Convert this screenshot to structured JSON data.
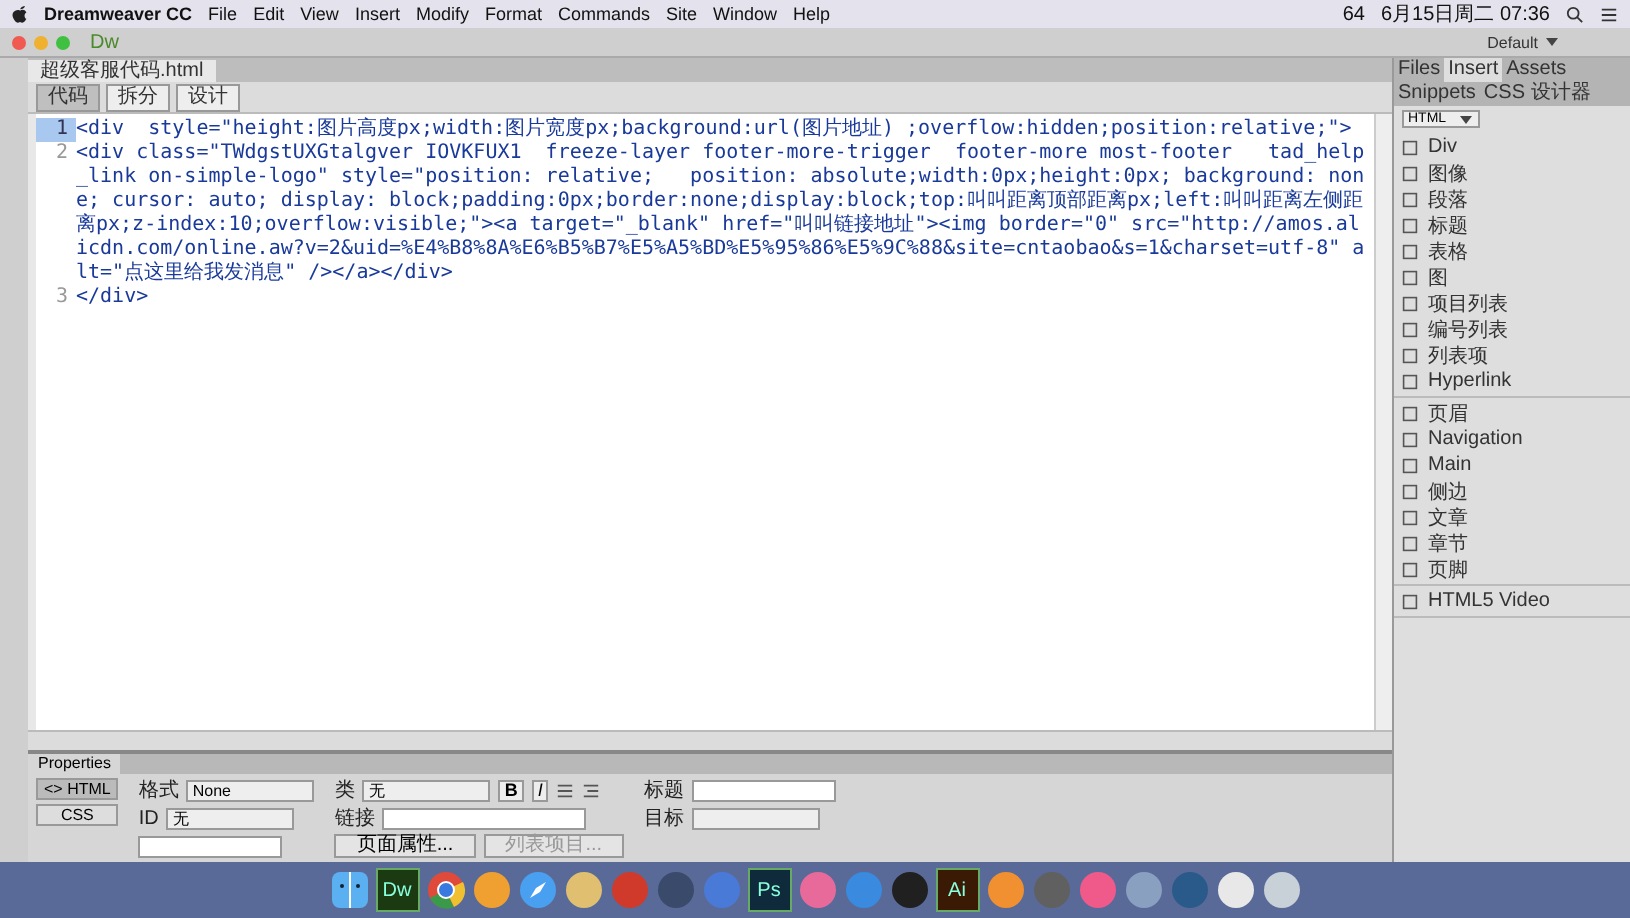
{
  "menubar": {
    "app": "Dreamweaver CC",
    "items": [
      "File",
      "Edit",
      "View",
      "Insert",
      "Modify",
      "Format",
      "Commands",
      "Site",
      "Window",
      "Help"
    ],
    "battery": "64",
    "clock": "6月15日周二 07:36"
  },
  "window": {
    "logo": "Dw",
    "workspace": "Default"
  },
  "document_tab": "超级客服代码.html",
  "view_buttons": [
    {
      "label": "代码",
      "selected": true
    },
    {
      "label": "拆分",
      "selected": false
    },
    {
      "label": "设计",
      "selected": false
    }
  ],
  "code_lines": [
    {
      "number": "1",
      "text": "<div  style=\"height:图片高度px;width:图片宽度px;background:url(图片地址) ;overflow:hidden;position:relative;\">"
    },
    {
      "number": "2",
      "text": "<div class=\"TWdgstUXGtalgver IOVKFUX1  freeze-layer footer-more-trigger  footer-more most-footer   tad_help_link on-simple-logo\" style=\"position: relative;   position: absolute;width:0px;height:0px; background: none; cursor: auto; display: block;padding:0px;border:none;display:block;top:叫叫距离顶部距离px;left:叫叫距离左侧距离px;z-index:10;overflow:visible;\"><a target=\"_blank\" href=\"叫叫链接地址\"><img border=\"0\" src=\"http://amos.alicdn.com/online.aw?v=2&uid=%E4%B8%8A%E6%B5%B7%E5%A5%BD%E5%95%86%E5%9C%88&site=cntaobao&s=1&charset=utf-8\" alt=\"点这里给我发消息\" /></a></div>"
    },
    {
      "number": "3",
      "text": "</div>"
    }
  ],
  "panel": {
    "tabs": [
      {
        "label": "Files",
        "selected": false
      },
      {
        "label": "Insert",
        "selected": true
      },
      {
        "label": "Assets",
        "selected": false
      },
      {
        "label": "Snippets",
        "selected": false
      },
      {
        "label": "CSS 设计器",
        "selected": false
      }
    ],
    "category": "HTML",
    "sections": [
      [
        "Div",
        "图像",
        "段落",
        "标题",
        "表格",
        "图",
        "项目列表",
        "编号列表",
        "列表项",
        "Hyperlink"
      ],
      [
        "页眉",
        "Navigation",
        "Main",
        "侧边",
        "文章",
        "章节",
        "页脚"
      ],
      [
        "HTML5 Video"
      ]
    ]
  },
  "properties": {
    "title": "Properties",
    "modes": [
      {
        "label": "<> HTML",
        "selected": true
      },
      {
        "label": "CSS",
        "selected": false
      }
    ],
    "bold_button": "B",
    "italic_button": "I",
    "format_label": "格式",
    "format_value": "None",
    "class_label": "类",
    "class_value": "无",
    "id_label": "ID",
    "id_value": "无",
    "link_label": "链接",
    "title_label": "标题",
    "target_label": "目标",
    "page_button": "页面属性...",
    "list_button": "列表项目..."
  },
  "dock": [
    {
      "kind": "finder"
    },
    {
      "kind": "tile",
      "label": "Dw",
      "color": "#1b3a12"
    },
    {
      "kind": "chrome"
    },
    {
      "kind": "circle",
      "color": "#f0a030"
    },
    {
      "kind": "compass"
    },
    {
      "kind": "circle",
      "color": "#e0c070"
    },
    {
      "kind": "circle",
      "color": "#d03a2a"
    },
    {
      "kind": "circle",
      "color": "#3a4a6a"
    },
    {
      "kind": "circle",
      "color": "#4a7ad8"
    },
    {
      "kind": "tile",
      "label": "Ps",
      "color": "#0f2a3a"
    },
    {
      "kind": "circle",
      "color": "#e86a9a"
    },
    {
      "kind": "circle",
      "color": "#3a8ae0"
    },
    {
      "kind": "circle",
      "color": "#202020"
    },
    {
      "kind": "tile",
      "label": "Ai",
      "color": "#3a1a05"
    },
    {
      "kind": "circle",
      "color": "#f09030"
    },
    {
      "kind": "circle",
      "color": "#606060"
    },
    {
      "kind": "circle",
      "color": "#f05a8a"
    },
    {
      "kind": "circle",
      "color": "#8aa0c0"
    },
    {
      "kind": "circle",
      "color": "#2a5a8a"
    },
    {
      "kind": "circle",
      "color": "#e8e8e8"
    },
    {
      "kind": "circle",
      "color": "#c8d0d8"
    }
  ]
}
